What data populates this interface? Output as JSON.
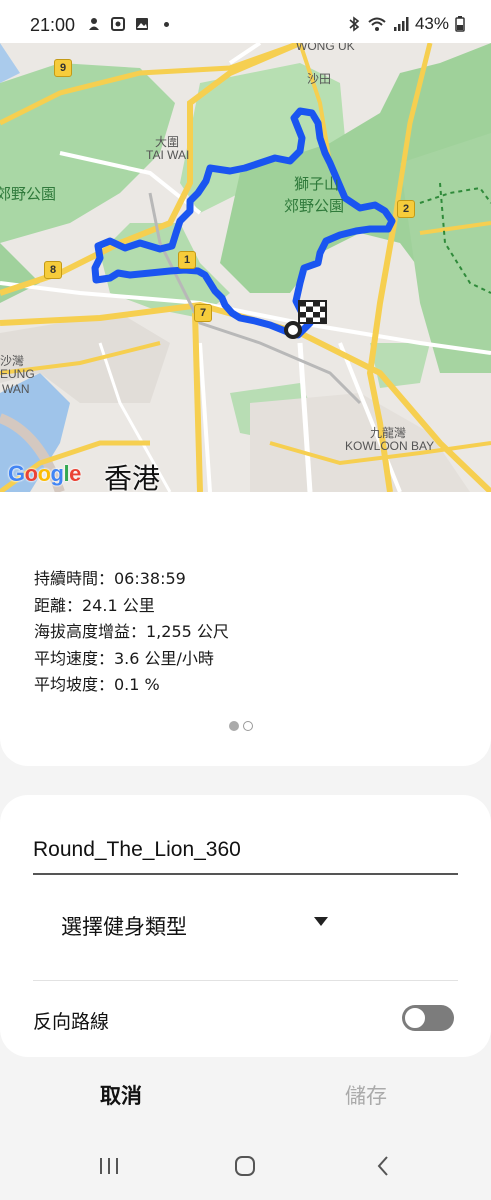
{
  "status_bar": {
    "time": "21:00",
    "battery": "43%"
  },
  "map": {
    "labels": {
      "wong_uk": "WONG UK",
      "sha_tin": "沙田",
      "tai_wai_cn": "大圍",
      "tai_wai_en": "TAI WAI",
      "lion_rock_1": "獅子山",
      "lion_rock_2": "郊野公園",
      "country_park_left": "郊野公園",
      "kowloon_bay_cn": "九龍灣",
      "kowloon_bay_en": "KOWLOON BAY",
      "sha_wan": "沙灣",
      "eung": "EUNG",
      "wan": "WAN",
      "hk": "香港"
    },
    "route_shields": [
      "9",
      "8",
      "1",
      "7",
      "2"
    ],
    "google": "Google",
    "route_color": "#1a55f0"
  },
  "stats": {
    "duration": "持續時間：06:38:59",
    "distance": "距離：24.1 公里",
    "elevation": "海拔高度增益：1,255 公尺",
    "avg_speed": "平均速度：3.6 公里/小時",
    "avg_gradient": "平均坡度：0.1 %"
  },
  "form": {
    "route_name": "Round_The_Lion_360",
    "workout_type": "選擇健身類型",
    "reverse_route_label": "反向路線",
    "reverse_route_on": false
  },
  "actions": {
    "cancel": "取消",
    "save": "儲存"
  }
}
